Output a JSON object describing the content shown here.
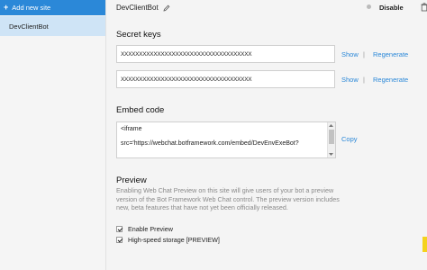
{
  "sidebar": {
    "add_site_label": "Add new site",
    "add_site_icon": "plus-icon",
    "items": [
      {
        "label": "DevClientBot",
        "selected": true
      }
    ]
  },
  "header": {
    "site_name": "DevClientBot",
    "disable_label": "Disable"
  },
  "secret_keys": {
    "heading": "Secret keys",
    "keys": [
      {
        "value": "XXXXXXXXXXXXXXXXXXXXXXXXXXXXXXXXXXXX",
        "show_label": "Show",
        "regenerate_label": "Regenerate"
      },
      {
        "value": "XXXXXXXXXXXXXXXXXXXXXXXXXXXXXXXXXXXX",
        "show_label": "Show",
        "regenerate_label": "Regenerate"
      }
    ],
    "separator": "|"
  },
  "embed": {
    "heading": "Embed code",
    "line1": "<iframe",
    "line2": "src='https://webchat.botframework.com/embed/DevEnvExeBot?",
    "copy_label": "Copy"
  },
  "preview": {
    "heading": "Preview",
    "description": "Enabling Web Chat Preview on this site will give users of your bot a preview version of the Bot Framework Web Chat control. The preview version includes new, beta features that have not yet been officially released.",
    "options": [
      {
        "label": "Enable Preview",
        "checked": true
      },
      {
        "label": "High-speed storage [PREVIEW]",
        "checked": true
      }
    ]
  },
  "colors": {
    "accent": "#2b88d8",
    "selected_item": "#cfe4f6",
    "marker": "#f4d21d"
  }
}
